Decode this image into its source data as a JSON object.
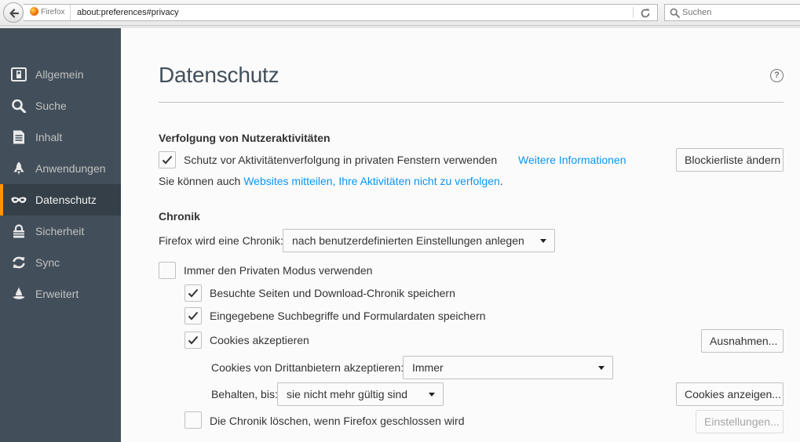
{
  "browser": {
    "identity_label": "Firefox",
    "url": "about:preferences#privacy",
    "search_placeholder": "Suchen"
  },
  "sidebar": {
    "items": [
      {
        "label": "Allgemein",
        "icon": "general-icon"
      },
      {
        "label": "Suche",
        "icon": "search-icon"
      },
      {
        "label": "Inhalt",
        "icon": "content-icon"
      },
      {
        "label": "Anwendungen",
        "icon": "applications-icon"
      },
      {
        "label": "Datenschutz",
        "icon": "privacy-mask-icon",
        "selected": true
      },
      {
        "label": "Sicherheit",
        "icon": "security-icon"
      },
      {
        "label": "Sync",
        "icon": "sync-icon"
      },
      {
        "label": "Erweitert",
        "icon": "advanced-icon"
      }
    ]
  },
  "page": {
    "title": "Datenschutz",
    "help_icon": "?"
  },
  "tracking": {
    "heading": "Verfolgung von Nutzeraktivitäten",
    "protection_label": "Schutz vor Aktivitätenverfolgung in privaten Fenstern verwenden",
    "protection_checked": true,
    "more_info_link": "Weitere Informationen",
    "blocklist_button": "Blockierliste ändern",
    "dnt_prefix": "Sie können auch ",
    "dnt_link": "Websites mitteilen, Ihre Aktivitäten nicht zu verfolgen",
    "dnt_suffix": "."
  },
  "history": {
    "heading": "Chronik",
    "mode_label": "Firefox wird eine Chronik:",
    "mode_value": "nach benutzerdefinierten Einstellungen anlegen",
    "private_mode_label": "Immer den Privaten Modus verwenden",
    "private_mode_checked": false,
    "visited_label": "Besuchte Seiten und Download-Chronik speichern",
    "visited_checked": true,
    "search_form_label": "Eingegebene Suchbegriffe und Formulardaten speichern",
    "search_form_checked": true,
    "cookies_label": "Cookies akzeptieren",
    "cookies_checked": true,
    "exceptions_button": "Ausnahmen...",
    "third_party_label": "Cookies von Drittanbietern akzeptieren:",
    "third_party_value": "Immer",
    "keep_label": "Behalten, bis:",
    "keep_value": "sie nicht mehr gültig sind",
    "show_cookies_button": "Cookies anzeigen...",
    "clear_on_close_label": "Die Chronik löschen, wenn Firefox geschlossen wird",
    "clear_on_close_checked": false,
    "settings_button": "Einstellungen..."
  },
  "colors": {
    "sidebar_bg": "#424f5a",
    "sidebar_selected_bg": "#343f48",
    "selected_accent": "#ff9500",
    "link": "#0996f8",
    "title": "#424f5a"
  }
}
